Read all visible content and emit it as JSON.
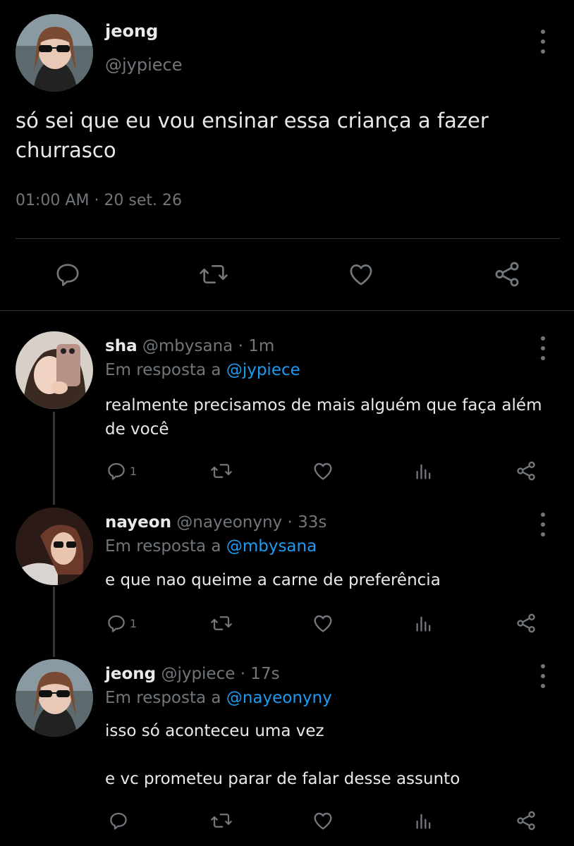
{
  "main_tweet": {
    "name": "jeong",
    "handle": "@jypiece",
    "text": "só sei que eu vou ensinar essa criança a fazer churrasco",
    "time": "01:00 AM",
    "separator": "·",
    "date": "20 set. 26"
  },
  "replies": [
    {
      "name": "sha",
      "handle": "@mbysana",
      "age": "· 1m",
      "reply_prefix": "Em resposta a",
      "reply_to": "@jypiece",
      "text": "realmente precisamos de mais alguém que faça além de você",
      "reply_count": "1"
    },
    {
      "name": "nayeon",
      "handle": "@nayeonyny",
      "age": "· 33s",
      "reply_prefix": "Em resposta a",
      "reply_to": "@mbysana",
      "text": "e que nao queime a carne de preferência",
      "reply_count": "1"
    },
    {
      "name": "jeong",
      "handle": "@jypiece",
      "age": "· 17s",
      "reply_prefix": "Em resposta a",
      "reply_to": "@nayeonyny",
      "text_line1": "isso só aconteceu uma vez",
      "text_line2": "e vc prometeu parar de falar desse assunto",
      "reply_count": ""
    }
  ],
  "colors": {
    "background": "#000000",
    "text": "#e7e9ea",
    "muted": "#71767b",
    "link": "#1d9bf0",
    "divider": "#2f3336"
  }
}
